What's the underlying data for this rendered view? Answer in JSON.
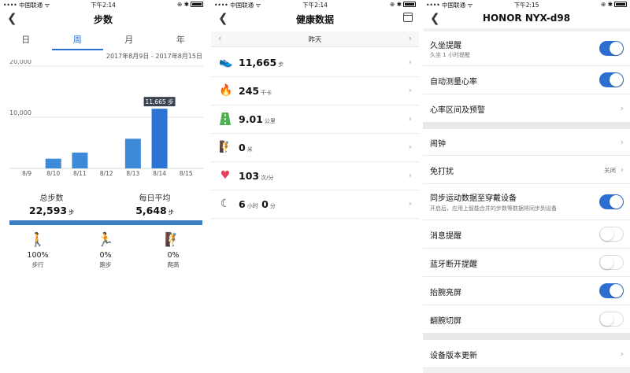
{
  "status": {
    "carrier": "•••• 中国联通 ᯤ",
    "times": [
      "下午2:14",
      "下午2:14",
      "下午2:15"
    ],
    "icons": "⊕ ✱"
  },
  "steps_screen": {
    "title": "步数",
    "tabs": [
      "日",
      "周",
      "月",
      "年"
    ],
    "active_tab": "周",
    "date_range": "2017年8月9日 - 2017年8月15日",
    "tooltip": "11,665 步",
    "total_label": "总步数",
    "total_value": "22,593",
    "total_unit": "步",
    "avg_label": "每日平均",
    "avg_value": "5,648",
    "avg_unit": "步",
    "activities": [
      {
        "pct": "100%",
        "name": "步行",
        "icon": "walking-icon",
        "color": "#3a7ec2"
      },
      {
        "pct": "0%",
        "name": "跑步",
        "icon": "running-icon",
        "color": "#e8623a"
      },
      {
        "pct": "0%",
        "name": "爬高",
        "icon": "climbing-icon",
        "color": "#2a9d8f"
      }
    ]
  },
  "chart_data": {
    "type": "bar",
    "categories": [
      "8/9",
      "8/10",
      "8/11",
      "8/12",
      "8/13",
      "8/14",
      "8/15"
    ],
    "values": [
      0,
      1900,
      3100,
      0,
      5800,
      11665,
      0
    ],
    "ylim": [
      0,
      20000
    ],
    "yticks": [
      "20,000",
      "10,000"
    ],
    "highlight_index": 5,
    "grid": true
  },
  "health_screen": {
    "title": "健康数据",
    "day": "昨天",
    "rows": [
      {
        "value": "11,665",
        "unit": "步",
        "icon": "shoe-icon",
        "color": "#3a7ec2"
      },
      {
        "value": "245",
        "unit": "千卡",
        "icon": "flame-icon",
        "color": "#f07a2a"
      },
      {
        "value": "9.01",
        "unit": "公里",
        "icon": "road-icon",
        "color": "#4caf50"
      },
      {
        "value": "0",
        "unit": "米",
        "icon": "climbing-icon",
        "color": "#2a9d8f"
      },
      {
        "value": "103",
        "unit": "次/分",
        "icon": "heart-icon",
        "color": "#e83e5c"
      },
      {
        "sleep_h": "6",
        "sleep_h_unit": "小时",
        "sleep_m": "0",
        "sleep_m_unit": "分",
        "icon": "moon-icon",
        "color": "#2c3e6b"
      }
    ]
  },
  "device_screen": {
    "title": "HONOR NYX-d98",
    "settings": [
      {
        "label": "久坐提醒",
        "sub": "久坐 1 小时提醒",
        "type": "toggle",
        "on": true
      },
      {
        "label": "自动测量心率",
        "type": "toggle",
        "on": true
      },
      {
        "label": "心率区间及预警",
        "type": "chevron"
      },
      {
        "label": "闹钟",
        "type": "chevron"
      },
      {
        "label": "免打扰",
        "value": "关闭",
        "type": "chevron"
      },
      {
        "label": "同步运动数据至穿戴设备",
        "sub": "开启后，应用上智能合并的步数等数据将同步到设备",
        "type": "toggle",
        "on": true
      },
      {
        "label": "消息提醒",
        "type": "toggle",
        "on": false
      },
      {
        "label": "蓝牙断开提醒",
        "type": "toggle",
        "on": false
      },
      {
        "label": "抬腕亮屏",
        "type": "toggle",
        "on": true
      },
      {
        "label": "翻腕切屏",
        "type": "toggle",
        "on": false
      },
      {
        "label": "设备版本更新",
        "type": "chevron"
      }
    ]
  }
}
